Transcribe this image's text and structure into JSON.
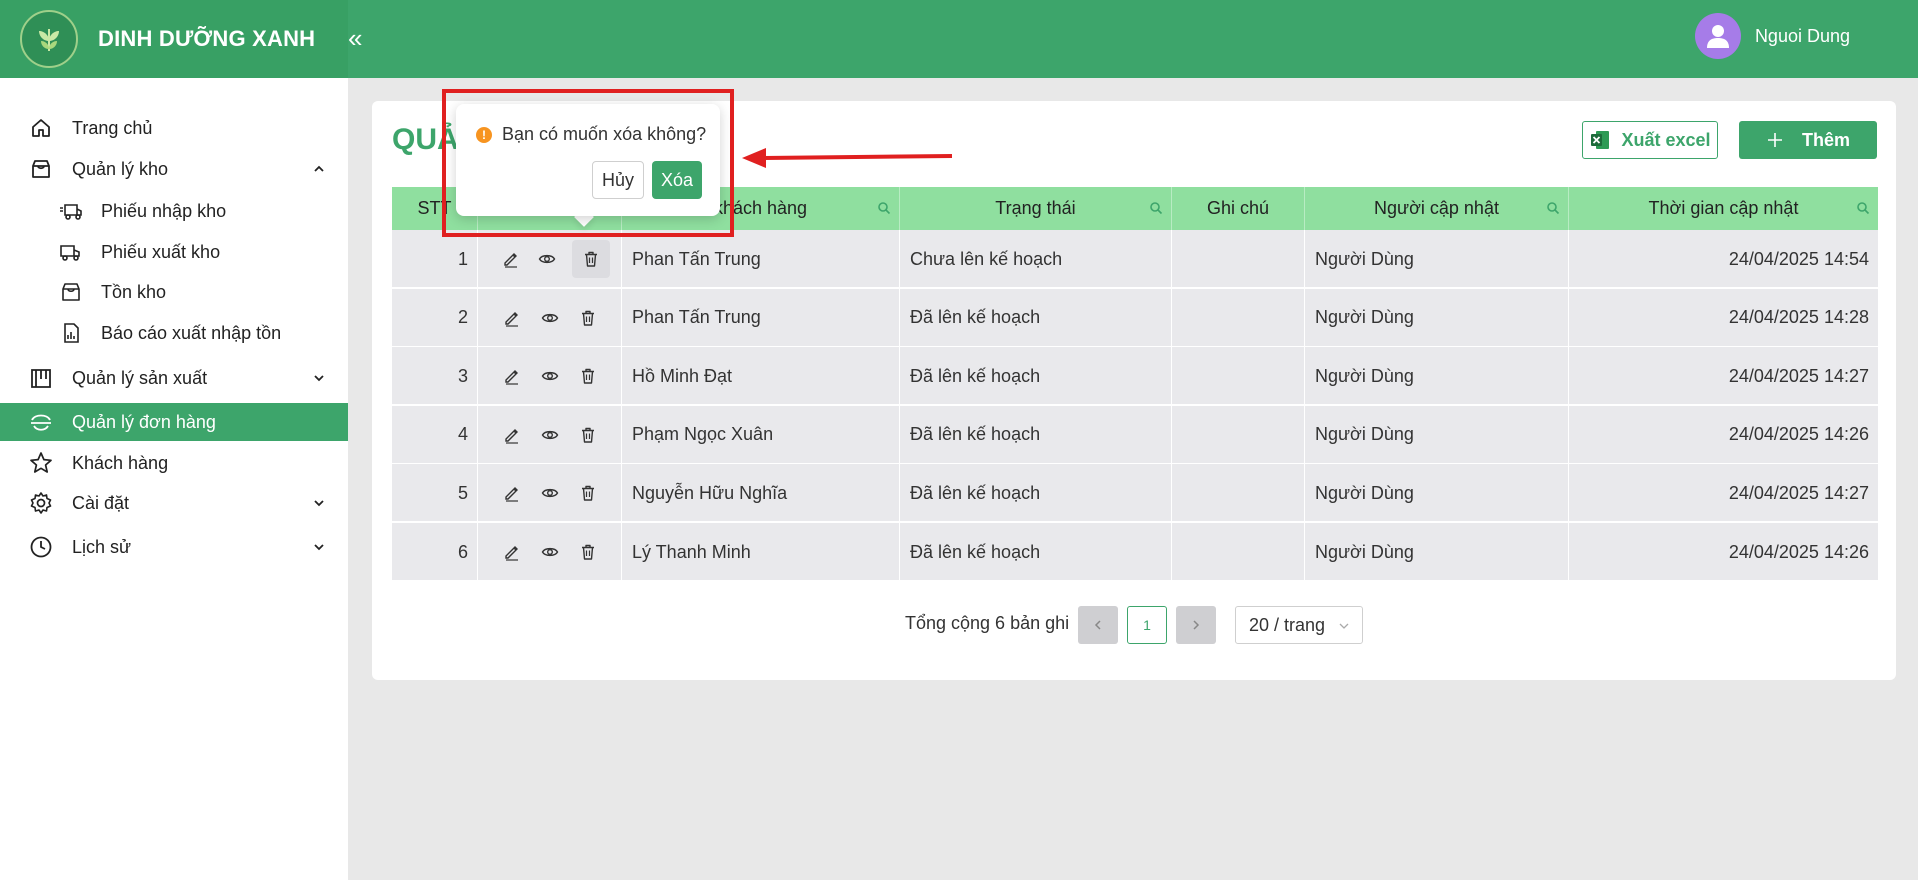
{
  "header": {
    "brand": "DINH DƯỠNG XANH",
    "collapse_icon": "«",
    "user_name": "Nguoi Dung"
  },
  "sidebar": {
    "items": [
      {
        "label": "Trang chủ",
        "icon": "home-icon"
      },
      {
        "label": "Quản lý kho",
        "icon": "warehouse-icon",
        "expanded": true
      },
      {
        "label": "Phiếu nhập kho",
        "icon": "truck-in-icon",
        "sub": true
      },
      {
        "label": "Phiếu xuất kho",
        "icon": "truck-out-icon",
        "sub": true
      },
      {
        "label": "Tồn kho",
        "icon": "inventory-icon",
        "sub": true
      },
      {
        "label": "Báo cáo xuất nhập tồn",
        "icon": "report-icon",
        "sub": true
      },
      {
        "label": "Quản lý sản xuất",
        "icon": "factory-icon"
      },
      {
        "label": "Quản lý đơn hàng",
        "icon": "order-icon",
        "active": true
      },
      {
        "label": "Khách hàng",
        "icon": "star-icon"
      },
      {
        "label": "Cài đặt",
        "icon": "gear-icon"
      },
      {
        "label": "Lịch sử",
        "icon": "history-icon"
      }
    ]
  },
  "main": {
    "title": "QUẢ",
    "export_label": "Xuất excel",
    "add_label": "Thêm",
    "columns": [
      "STT",
      "",
      "khách hàng",
      "Trạng thái",
      "Ghi chú",
      "Người cập nhật",
      "Thời gian cập nhật"
    ],
    "rows": [
      {
        "stt": "1",
        "customer": "Phan Tấn Trung",
        "status": "Chưa lên kế hoạch",
        "note": "",
        "updated_by": "Người Dùng",
        "updated_at": "24/04/2025 14:54"
      },
      {
        "stt": "2",
        "customer": "Phan Tấn Trung",
        "status": "Đã lên kế hoạch",
        "note": "",
        "updated_by": "Người Dùng",
        "updated_at": "24/04/2025 14:28"
      },
      {
        "stt": "3",
        "customer": "Hồ Minh Đạt",
        "status": "Đã lên kế hoạch",
        "note": "",
        "updated_by": "Người Dùng",
        "updated_at": "24/04/2025 14:27"
      },
      {
        "stt": "4",
        "customer": "Phạm Ngọc Xuân",
        "status": "Đã lên kế hoạch",
        "note": "",
        "updated_by": "Người Dùng",
        "updated_at": "24/04/2025 14:26"
      },
      {
        "stt": "5",
        "customer": "Nguyễn Hữu Nghĩa",
        "status": "Đã lên kế hoạch",
        "note": "",
        "updated_by": "Người Dùng",
        "updated_at": "24/04/2025 14:27"
      },
      {
        "stt": "6",
        "customer": "Lý Thanh Minh",
        "status": "Đã lên kế hoạch",
        "note": "",
        "updated_by": "Người Dùng",
        "updated_at": "24/04/2025 14:26"
      }
    ],
    "pagination": {
      "total": "Tổng cộng 6 bản ghi",
      "current_page": "1",
      "page_size": "20 / trang"
    }
  },
  "popconfirm": {
    "message": "Bạn có muốn xóa không?",
    "cancel_label": "Hủy",
    "ok_label": "Xóa"
  },
  "colors": {
    "brand_green": "#3da56b",
    "table_header": "#8fdf9f",
    "annotation_red": "#e02020"
  }
}
